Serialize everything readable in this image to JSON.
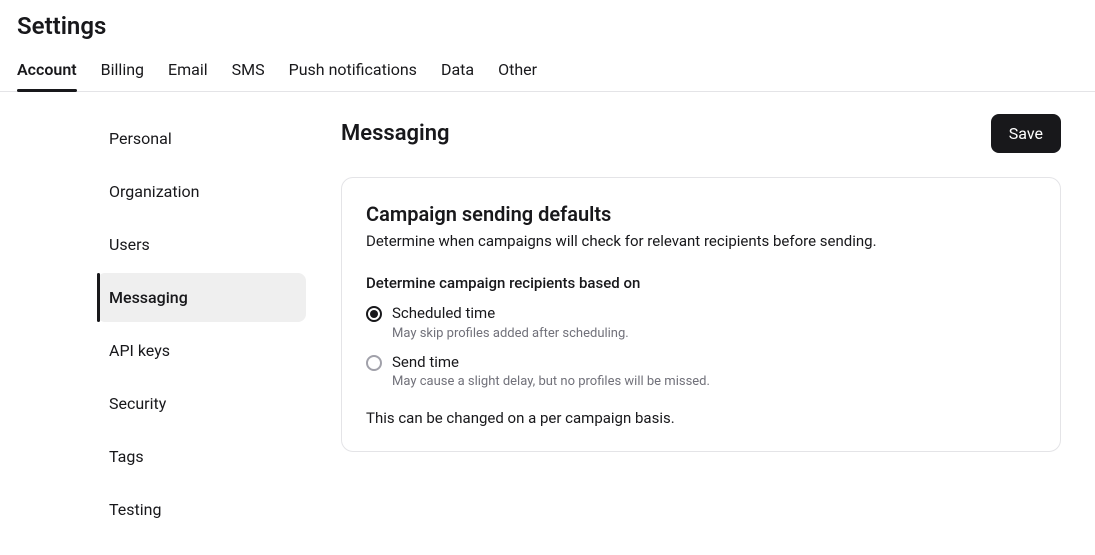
{
  "pageTitle": "Settings",
  "tabs": [
    "Account",
    "Billing",
    "Email",
    "SMS",
    "Push notifications",
    "Data",
    "Other"
  ],
  "sidebar": [
    "Personal",
    "Organization",
    "Users",
    "Messaging",
    "API keys",
    "Security",
    "Tags",
    "Testing"
  ],
  "main": {
    "title": "Messaging",
    "saveLabel": "Save",
    "card": {
      "title": "Campaign sending defaults",
      "description": "Determine when campaigns will check for relevant recipients before sending.",
      "fieldLabel": "Determine campaign recipients based on",
      "options": [
        {
          "label": "Scheduled time",
          "sub": "May skip profiles added after scheduling."
        },
        {
          "label": "Send time",
          "sub": "May cause a slight delay, but no profiles will be missed."
        }
      ],
      "footnote": "This can be changed on a per campaign basis."
    }
  }
}
